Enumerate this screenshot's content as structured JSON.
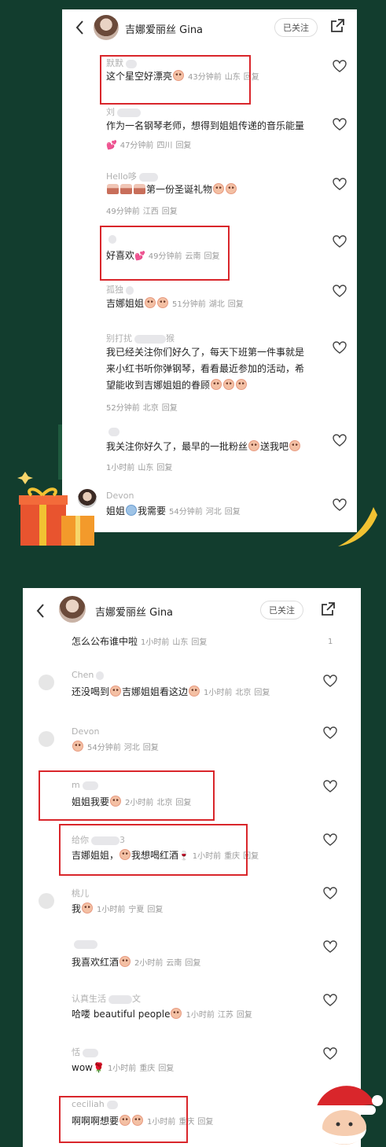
{
  "header": {
    "name": "吉娜爱丽丝 Gina",
    "follow_label": "已关注"
  },
  "panel1": {
    "comments": [
      {
        "user": "默默",
        "text": "这个星空好漂亮",
        "time": "43分钟前",
        "loc": "山东",
        "reply": "回复"
      },
      {
        "user": "刘",
        "text": "作为一名钢琴老师，想得到姐姐传递的音乐能量",
        "time": "47分钟前",
        "loc": "四川",
        "reply": "回复"
      },
      {
        "user": "Hello哆",
        "text": "第一份圣诞礼物",
        "time": "49分钟前",
        "loc": "江西",
        "reply": "回复"
      },
      {
        "user": "",
        "text": "好喜欢",
        "time": "49分钟前",
        "loc": "云南",
        "reply": "回复"
      },
      {
        "user": "孤独",
        "text": "吉娜姐姐",
        "time": "51分钟前",
        "loc": "湖北",
        "reply": "回复"
      },
      {
        "user": "别打扰",
        "user_tail": "猴",
        "text1": "我已经关注你们好久了，每天下班第一件事就是",
        "text2": "来小红书听你弹钢琴，看看最近参加的活动，希",
        "text3": "望能收到吉娜姐姐的眷顾",
        "time": "52分钟前",
        "loc": "北京",
        "reply": "回复"
      },
      {
        "user": "",
        "text": "我关注你好久了，最早的一批粉丝",
        "text_tail": "送我吧",
        "time": "1小时前",
        "loc": "山东",
        "reply": "回复"
      },
      {
        "user": "Devon",
        "text_a": "姐姐",
        "text_b": "我需要",
        "time": "54分钟前",
        "loc": "河北",
        "reply": "回复"
      }
    ]
  },
  "panel2": {
    "comments": [
      {
        "text": "怎么公布谁中啦",
        "time": "1小时前",
        "loc": "山东",
        "reply": "回复",
        "count": "1"
      },
      {
        "user": "Chen",
        "text_a": "还没喝到",
        "text_b": "吉娜姐姐看这边",
        "time": "1小时前",
        "loc": "北京",
        "reply": "回复"
      },
      {
        "user": "Devon",
        "time": "54分钟前",
        "loc": "河北",
        "reply": "回复"
      },
      {
        "user": "m",
        "text": "姐姐我要",
        "time": "2小时前",
        "loc": "北京",
        "reply": "回复"
      },
      {
        "user": "给你",
        "user_tail": "3",
        "text_a": "吉娜姐姐，",
        "text_b": "我想喝红酒",
        "time": "1小时前",
        "loc": "重庆",
        "reply": "回复"
      },
      {
        "user": "桃儿",
        "text": "我",
        "time": "1小时前",
        "loc": "宁夏",
        "reply": "回复"
      },
      {
        "user": "",
        "text": "我喜欢红酒",
        "time": "2小时前",
        "loc": "云南",
        "reply": "回复"
      },
      {
        "user": "认真生活",
        "user_tail": "文",
        "text": "哈喽 beautiful people",
        "time": "1小时前",
        "loc": "江苏",
        "reply": "回复"
      },
      {
        "user": "恬",
        "text": "wow",
        "time": "1小时前",
        "loc": "重庆",
        "reply": "回复"
      },
      {
        "user": "ceciliah",
        "text": "啊啊啊想要",
        "time": "1小时前",
        "loc": "重庆",
        "reply": "回复"
      }
    ]
  },
  "colors": {
    "background": "#123d2e",
    "highlight_box": "#d9262b"
  }
}
